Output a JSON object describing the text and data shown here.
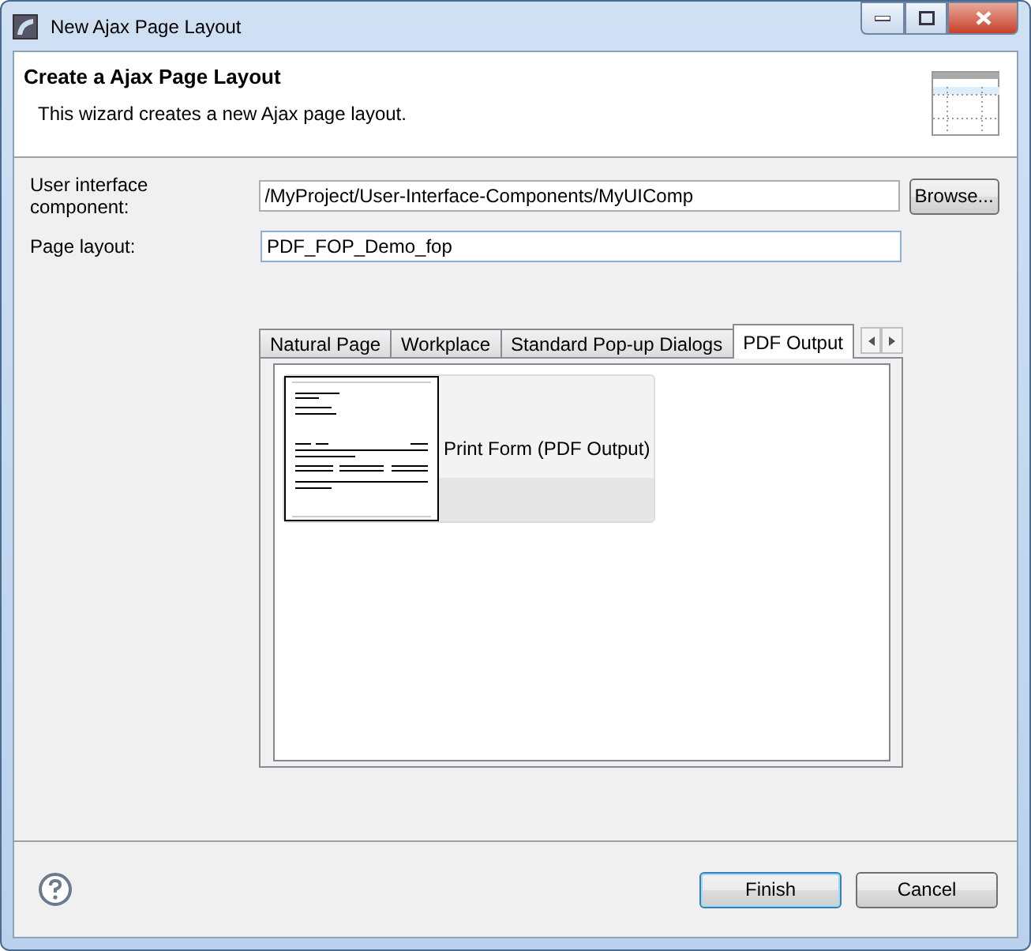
{
  "window": {
    "title": "New Ajax Page Layout"
  },
  "header": {
    "title": "Create a Ajax Page Layout",
    "description": "This wizard creates a new Ajax page layout."
  },
  "fields": [
    {
      "label": "User interface component:",
      "value": "/MyProject/User-Interface-Components/MyUIComp",
      "button": "Browse..."
    },
    {
      "label": "Page layout:",
      "value": "PDF_FOP_Demo_fop"
    }
  ],
  "tabs": [
    {
      "label": "Natural Page",
      "selected": false
    },
    {
      "label": "Workplace",
      "selected": false
    },
    {
      "label": "Standard Pop-up Dialogs",
      "selected": false
    },
    {
      "label": "PDF Output",
      "selected": true
    }
  ],
  "templates": [
    {
      "label": "Print Form (PDF Output)",
      "selected": true
    }
  ],
  "buttons": [
    {
      "label": "Finish",
      "default": true
    },
    {
      "label": "Cancel",
      "default": false
    }
  ]
}
